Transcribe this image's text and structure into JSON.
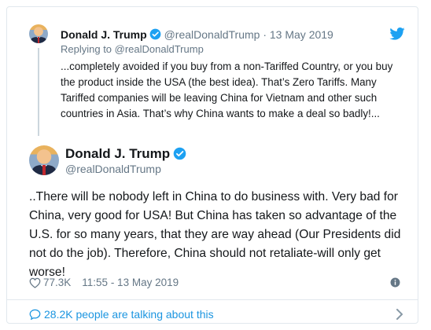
{
  "parent_tweet": {
    "name": "Donald J. Trump",
    "handle": "@realDonaldTrump",
    "separator": "·",
    "date": "13 May 2019",
    "replying_to": "Replying to @realDonaldTrump",
    "text": "...completely avoided if you buy from a non-Tariffed Country, or you buy the product inside the USA (the best idea). That’s Zero Tariffs. Many Tariffed companies will be leaving China for Vietnam and other such countries in Asia. That’s why China wants to make a deal so badly!..."
  },
  "main_tweet": {
    "name": "Donald J. Trump",
    "handle": "@realDonaldTrump",
    "text": "..There will be nobody left in China to do business with. Very bad for China, very good for USA! But China has taken so advantage of the U.S. for so many years, that they are way ahead (Our Presidents did not do the job). Therefore, China should not retaliate-will only get worse!",
    "likes": "77.3K",
    "time": "11:55 - 13 May 2019"
  },
  "footer": {
    "talking": "28.2K people are talking about this"
  },
  "icons": {
    "brand_color": "#1da1f2",
    "verified": "verified-badge-icon",
    "bird": "twitter-bird-icon",
    "heart": "heart-icon",
    "info": "info-icon",
    "comments": "speech-bubble-icon",
    "chevron": "chevron-right-icon"
  }
}
